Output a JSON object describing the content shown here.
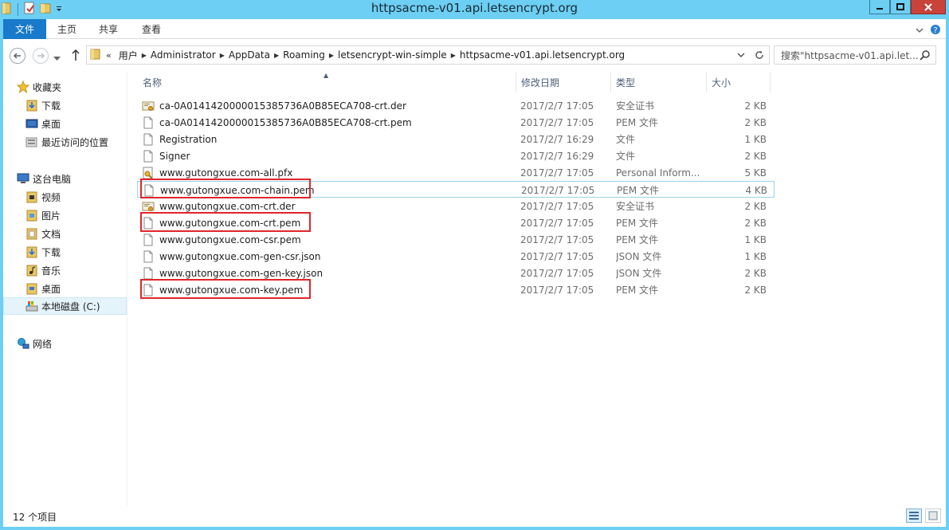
{
  "window": {
    "title": "httpsacme-v01.api.letsencrypt.org",
    "controls": [
      "minimize-icon",
      "maximize-icon",
      "close-icon"
    ]
  },
  "ribbon": {
    "tabs": [
      "文件",
      "主页",
      "共享",
      "查看"
    ]
  },
  "address": {
    "breadcrumb": [
      "用户",
      "Administrator",
      "AppData",
      "Roaming",
      "letsencrypt-win-simple",
      "httpsacme-v01.api.letsencrypt.org"
    ],
    "search_placeholder": "搜索\"httpsacme-v01.api.let..."
  },
  "navpane": {
    "favorites": {
      "label": "收藏夹",
      "icon": "star-icon"
    },
    "favorite_items": [
      {
        "label": "下载",
        "icon": "download-folder-icon"
      },
      {
        "label": "桌面",
        "icon": "desktop-icon"
      },
      {
        "label": "最近访问的位置",
        "icon": "recent-places-icon"
      }
    ],
    "this_pc": {
      "label": "这台电脑",
      "icon": "computer-icon"
    },
    "pc_items": [
      {
        "label": "视频",
        "icon": "videos-folder-icon"
      },
      {
        "label": "图片",
        "icon": "pictures-folder-icon"
      },
      {
        "label": "文档",
        "icon": "documents-folder-icon"
      },
      {
        "label": "下载",
        "icon": "download-folder-icon"
      },
      {
        "label": "音乐",
        "icon": "music-folder-icon"
      },
      {
        "label": "桌面",
        "icon": "desktop-folder-icon"
      },
      {
        "label": "本地磁盘 (C:)",
        "icon": "local-disk-icon"
      }
    ],
    "network": {
      "label": "网络",
      "icon": "network-icon"
    }
  },
  "columns": {
    "name": "名称",
    "modified": "修改日期",
    "type": "类型",
    "size": "大小"
  },
  "files": [
    {
      "name": "ca-0A0141420000015385736A0B85ECA708-crt.der",
      "modified": "2017/2/7 17:05",
      "type": "安全证书",
      "size": "2 KB",
      "icon": "certificate-icon"
    },
    {
      "name": "ca-0A0141420000015385736A0B85ECA708-crt.pem",
      "modified": "2017/2/7 17:05",
      "type": "PEM 文件",
      "size": "2 KB",
      "icon": "file-icon"
    },
    {
      "name": "Registration",
      "modified": "2017/2/7 16:29",
      "type": "文件",
      "size": "1 KB",
      "icon": "file-icon"
    },
    {
      "name": "Signer",
      "modified": "2017/2/7 16:29",
      "type": "文件",
      "size": "2 KB",
      "icon": "file-icon"
    },
    {
      "name": "www.gutongxue.com-all.pfx",
      "modified": "2017/2/7 17:05",
      "type": "Personal Inform...",
      "size": "5 KB",
      "icon": "pfx-certificate-icon"
    },
    {
      "name": "www.gutongxue.com-chain.pem",
      "modified": "2017/2/7 17:05",
      "type": "PEM 文件",
      "size": "4 KB",
      "icon": "file-icon"
    },
    {
      "name": "www.gutongxue.com-crt.der",
      "modified": "2017/2/7 17:05",
      "type": "安全证书",
      "size": "2 KB",
      "icon": "certificate-icon"
    },
    {
      "name": "www.gutongxue.com-crt.pem",
      "modified": "2017/2/7 17:05",
      "type": "PEM 文件",
      "size": "2 KB",
      "icon": "file-icon"
    },
    {
      "name": "www.gutongxue.com-csr.pem",
      "modified": "2017/2/7 17:05",
      "type": "PEM 文件",
      "size": "1 KB",
      "icon": "file-icon"
    },
    {
      "name": "www.gutongxue.com-gen-csr.json",
      "modified": "2017/2/7 17:05",
      "type": "JSON 文件",
      "size": "1 KB",
      "icon": "file-icon"
    },
    {
      "name": "www.gutongxue.com-gen-key.json",
      "modified": "2017/2/7 17:05",
      "type": "JSON 文件",
      "size": "2 KB",
      "icon": "file-icon"
    },
    {
      "name": "www.gutongxue.com-key.pem",
      "modified": "2017/2/7 17:05",
      "type": "PEM 文件",
      "size": "2 KB",
      "icon": "file-icon"
    }
  ],
  "annotations": {
    "red_boxes_on": [
      "www.gutongxue.com-chain.pem",
      "www.gutongxue.com-crt.pem",
      "www.gutongxue.com-key.pem"
    ],
    "color": "#e0262b"
  },
  "status": {
    "item_count": "12 个项目"
  },
  "colors": {
    "title_bar": "#6ccff3",
    "file_tab": "#1979ca",
    "annotation_red": "#e0262b",
    "selection": "#e5f3fb"
  }
}
